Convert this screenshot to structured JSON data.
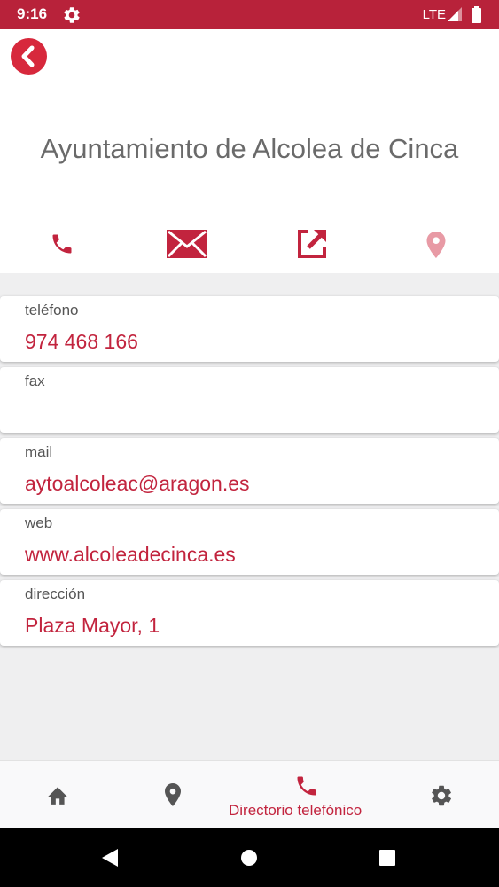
{
  "status_bar": {
    "time": "9:16",
    "network": "LTE",
    "icons": [
      "gear-icon",
      "signal-icon",
      "battery-icon"
    ],
    "color": "#b8223a"
  },
  "header": {
    "title": "Ayuntamiento de Alcolea de Cinca",
    "back_icon": "chevron-left-icon",
    "actions": [
      "phone-icon",
      "mail-icon",
      "open-external-icon",
      "location-pin-icon"
    ]
  },
  "contact": {
    "items": [
      {
        "label": "teléfono",
        "value": "974 468 166"
      },
      {
        "label": "fax",
        "value": ""
      },
      {
        "label": "mail",
        "value": "aytoalcoleac@aragon.es"
      },
      {
        "label": "web",
        "value": "www.alcoleadecinca.es"
      },
      {
        "label": "dirección",
        "value": "Plaza Mayor, 1"
      }
    ]
  },
  "bottom_nav": {
    "items": [
      {
        "icon": "home-icon"
      },
      {
        "icon": "location-pin-icon"
      },
      {
        "icon": "phone-icon",
        "label": "Directorio telefónico",
        "active": true
      },
      {
        "icon": "gear-icon"
      }
    ]
  },
  "system_nav": {
    "icons": [
      "back-triangle-icon",
      "home-circle-icon",
      "recents-square-icon"
    ]
  },
  "colors": {
    "accent": "#c2243e",
    "accent_light": "#e89aa5",
    "title_gray": "#6a6a6a",
    "background": "#efeff0"
  }
}
